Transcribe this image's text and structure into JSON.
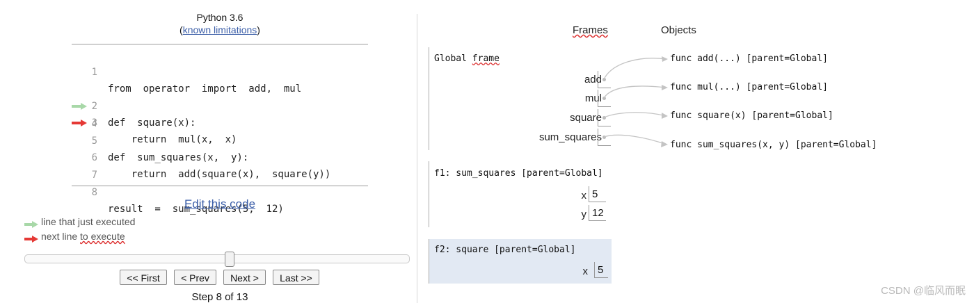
{
  "header": {
    "python_version": "Python 3.6",
    "limitations_open": "(",
    "limitations_link": "known limitations",
    "limitations_close": ")"
  },
  "code": {
    "lines": [
      {
        "no": "1",
        "text": "from  operator  import  add,  mul"
      },
      {
        "no": "2",
        "text": "def  square(x):"
      },
      {
        "no": "3",
        "text": "    return  mul(x,  x)"
      },
      {
        "no": "4",
        "text": ""
      },
      {
        "no": "5",
        "text": "def  sum_squares(x,  y):"
      },
      {
        "no": "6",
        "text": "    return  add(square(x),  square(y))"
      },
      {
        "no": "7",
        "text": ""
      },
      {
        "no": "8",
        "text": "result  =  sum_squares(5,  12)"
      }
    ],
    "just_executed_line": 2,
    "next_line": 3
  },
  "edit_link": "Edit this code",
  "legend": {
    "just_executed": "line that just executed",
    "next_line": "next line to execute"
  },
  "colors": {
    "just_executed_arrow": "#a8d8a8",
    "next_line_arrow": "#e53935",
    "active_frame_bg": "#e2e9f3",
    "link": "#3b5ea8"
  },
  "slider": {
    "step": 8,
    "total": 13
  },
  "nav": {
    "first": "<< First",
    "prev": "< Prev",
    "next": "Next >",
    "last": "Last >>"
  },
  "step_counter": "Step 8 of 13",
  "viz": {
    "frames_header": "Frames",
    "objects_header": "Objects",
    "global_frame": {
      "title": "Global frame",
      "vars": [
        "add",
        "mul",
        "square",
        "sum_squares"
      ]
    },
    "frame_f1": {
      "title": "f1: sum_squares [parent=Global]",
      "vars": [
        {
          "name": "x",
          "value": "5"
        },
        {
          "name": "y",
          "value": "12"
        }
      ]
    },
    "frame_f2": {
      "title": "f2: square [parent=Global]",
      "vars": [
        {
          "name": "x",
          "value": "5"
        }
      ]
    },
    "objects": [
      "func add(...) [parent=Global]",
      "func mul(...) [parent=Global]",
      "func square(x) [parent=Global]",
      "func sum_squares(x,  y) [parent=Global]"
    ]
  },
  "watermark": "CSDN @临风而眠"
}
